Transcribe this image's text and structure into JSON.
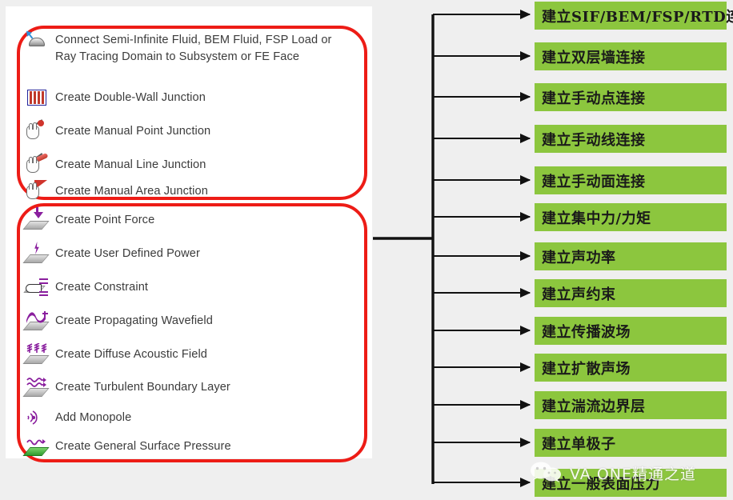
{
  "left_panel": {
    "groups": [
      {
        "name": "junction-commands",
        "highlight_color": "#ed1c16",
        "items": [
          {
            "icon": "semi-infinite-fluid-dome-icon",
            "label": "Connect Semi-Infinite Fluid, BEM Fluid, FSP Load or\nRay Tracing Domain to Subsystem or FE Face"
          },
          {
            "icon": "double-wall-books-icon",
            "label": "Create Double-Wall Junction"
          },
          {
            "icon": "hand-point-icon",
            "label": "Create Manual Point Junction"
          },
          {
            "icon": "hand-line-icon",
            "label": "Create Manual Line Junction"
          },
          {
            "icon": "hand-area-icon",
            "label": "Create Manual Area Junction"
          }
        ]
      },
      {
        "name": "load-commands",
        "highlight_color": "#ed1c16",
        "items": [
          {
            "icon": "point-force-icon",
            "label": "Create Point Force"
          },
          {
            "icon": "user-defined-power-icon",
            "label": "Create User Defined Power"
          },
          {
            "icon": "constraint-icon",
            "label": "Create Constraint"
          },
          {
            "icon": "propagating-wavefield-icon",
            "label": "Create Propagating Wavefield"
          },
          {
            "icon": "diffuse-acoustic-field-icon",
            "label": "Create Diffuse Acoustic Field"
          },
          {
            "icon": "turbulent-boundary-layer-icon",
            "label": "Create Turbulent Boundary Layer"
          },
          {
            "icon": "monopole-icon",
            "label": "Add Monopole"
          },
          {
            "icon": "general-surface-pressure-icon",
            "label": "Create General Surface Pressure"
          }
        ]
      }
    ]
  },
  "translations": {
    "box_color": "#8cc63e",
    "items": [
      "建立SIF/BEM/FSP/RTD连接",
      "建立双层墙连接",
      "建立手动点连接",
      "建立手动线连接",
      "建立手动面连接",
      "建立集中力/力矩",
      "建立声功率",
      "建立声约束",
      "建立传播波场",
      "建立扩散声场",
      "建立湍流边界层",
      "建立单极子",
      "建立一般表面压力"
    ]
  },
  "watermark": {
    "text": "VA ONE精通之道",
    "icon": "wechat-logo-icon"
  }
}
